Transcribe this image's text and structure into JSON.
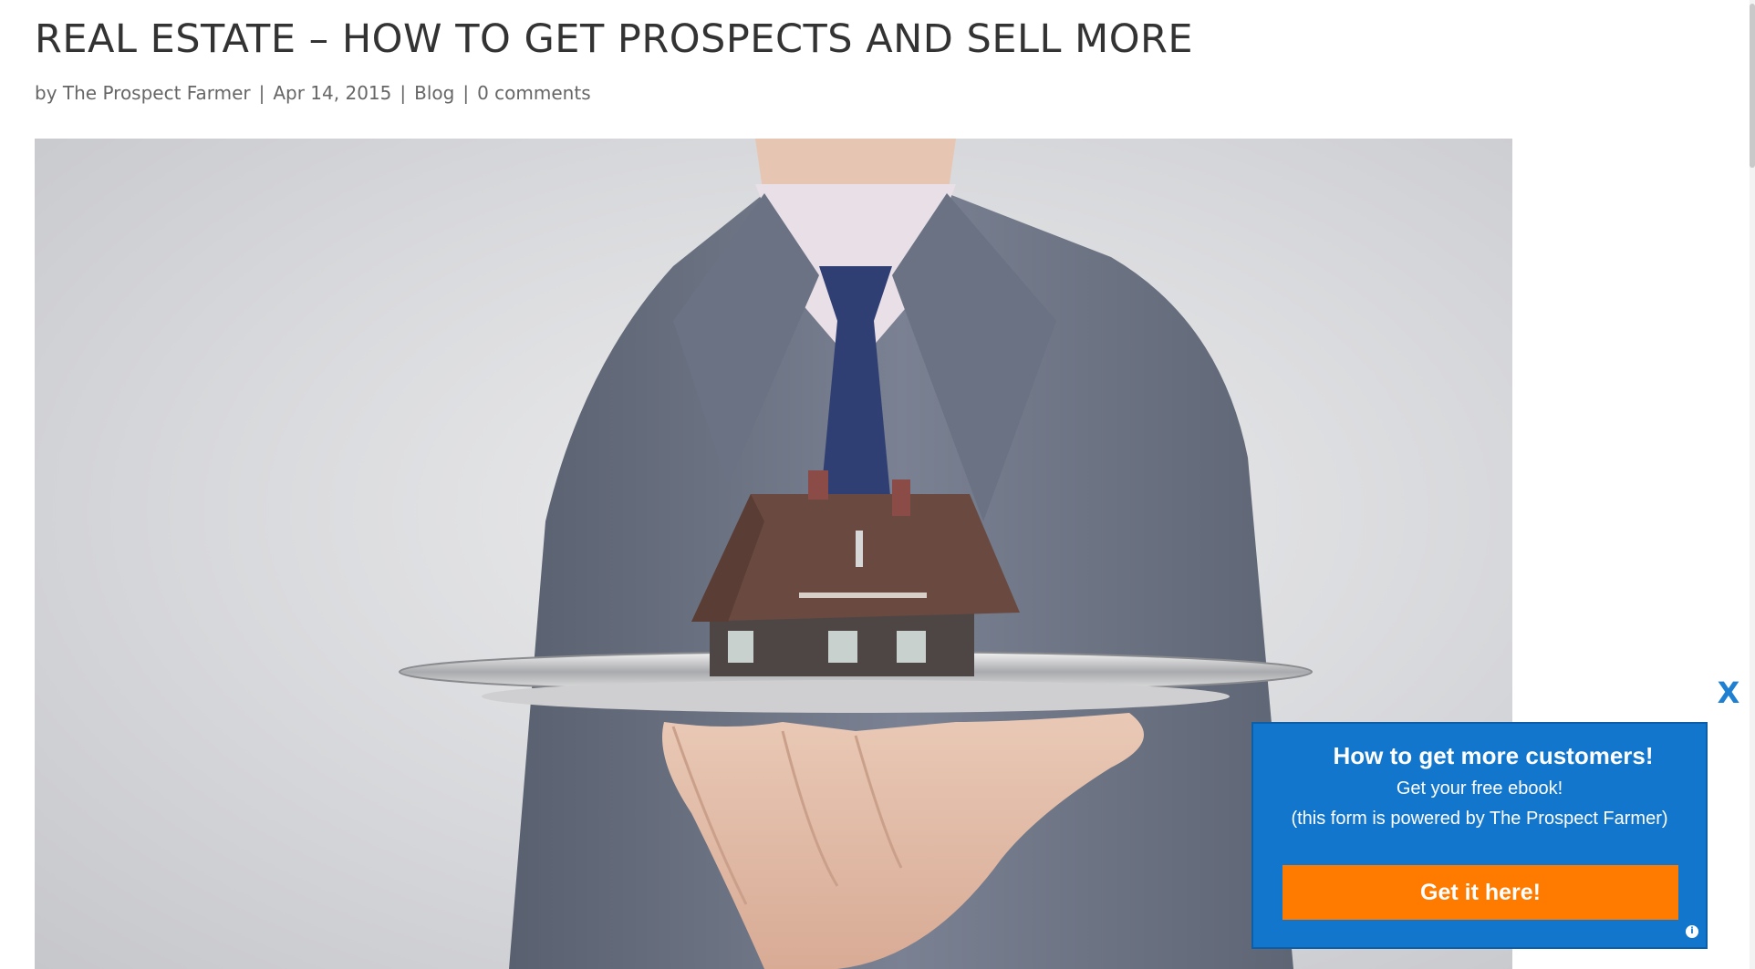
{
  "post": {
    "title": "REAL ESTATE – HOW TO GET PROSPECTS AND SELL MORE",
    "meta": {
      "by_prefix": "by",
      "author": "The Prospect Farmer",
      "separator": "|",
      "date": "Apr 14, 2015",
      "category": "Blog",
      "comments": "0 comments"
    }
  },
  "hero_image": {
    "subject": "businessman in suit holding a silver tray with a model house"
  },
  "popup": {
    "close_label": "X",
    "heading": "How to get more customers!",
    "subheading": "Get your free ebook!",
    "note": "(this form is powered by The Prospect Farmer)",
    "cta_label": "Get it here!",
    "info_label": "i",
    "colors": {
      "background": "#1176cc",
      "cta": "#ff7b00",
      "close": "#1f7fd1"
    }
  }
}
